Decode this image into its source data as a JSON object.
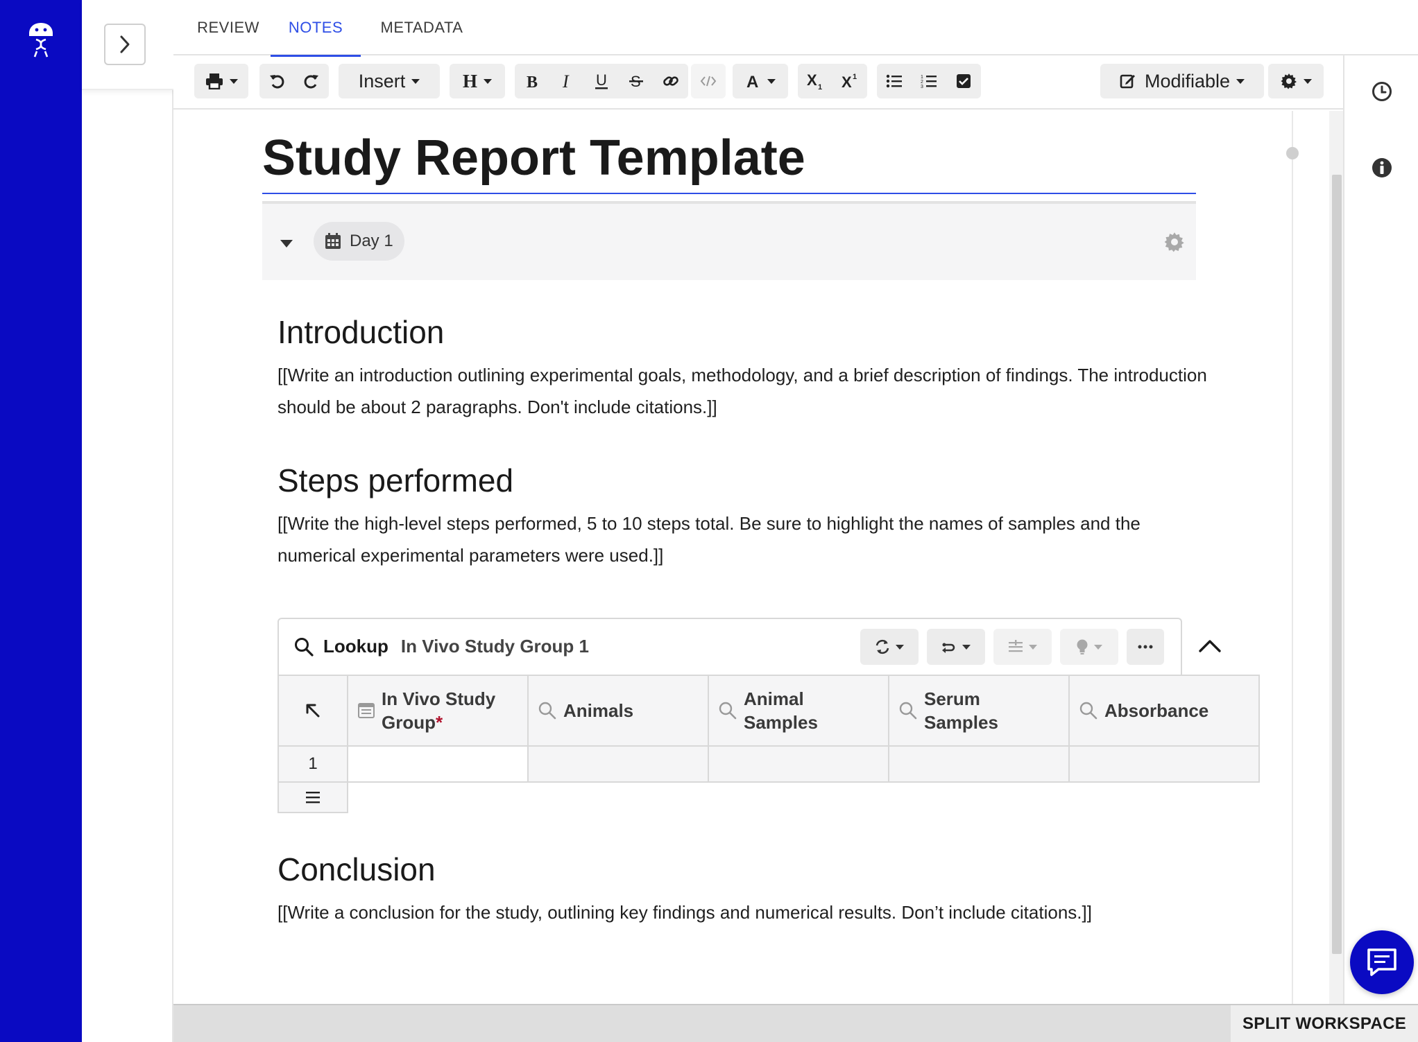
{
  "tabs": [
    {
      "label": "REVIEW",
      "active": false
    },
    {
      "label": "NOTES",
      "active": true
    },
    {
      "label": "METADATA",
      "active": false
    }
  ],
  "toolbar": {
    "insert_label": "Insert",
    "heading_label": "H",
    "mode_label": "Modifiable",
    "icons": [
      "print-icon",
      "undo-icon",
      "redo-icon",
      "bold-icon",
      "italic-icon",
      "underline-icon",
      "strikethrough-icon",
      "link-icon",
      "code-icon",
      "text-color-icon",
      "subscript-icon",
      "superscript-icon",
      "bullet-list-icon",
      "numbered-list-icon",
      "checklist-icon",
      "edit-icon",
      "gear-icon"
    ]
  },
  "document": {
    "title": "Study Report Template",
    "day_label": "Day 1",
    "sections": [
      {
        "heading": "Introduction",
        "body": "[[Write an introduction outlining experimental goals, methodology, and a brief description of findings. The introduction should be about 2 paragraphs. Don't include citations.]]"
      },
      {
        "heading": "Steps performed",
        "body": "[[Write the high-level steps performed, 5 to 10 steps total. Be sure to highlight the names of samples and the numerical experimental parameters were used.]]"
      },
      {
        "heading": "Conclusion",
        "body": "[[Write a conclusion for the study, outlining key findings and numerical results. Don’t include citations.]]"
      }
    ]
  },
  "lookup": {
    "label": "Lookup",
    "entity": "In Vivo Study Group 1",
    "columns": [
      {
        "line1": "In Vivo Study",
        "line2": "Group",
        "required_mark": "*",
        "icon": "table-icon"
      },
      {
        "line1": "Animals",
        "line2": "",
        "required_mark": "",
        "icon": "search-icon"
      },
      {
        "line1": "Animal",
        "line2": "Samples",
        "required_mark": "",
        "icon": "search-icon"
      },
      {
        "line1": "Serum",
        "line2": "Samples",
        "required_mark": "",
        "icon": "search-icon"
      },
      {
        "line1": "Absorbance",
        "line2": "",
        "required_mark": "",
        "icon": "search-icon"
      }
    ],
    "rows": [
      {
        "index": "1"
      }
    ]
  },
  "footer": {
    "split_label": "SPLIT WORKSPACE"
  },
  "colors": {
    "brand": "#0a0ac2",
    "accent": "#2e4ee6",
    "required": "#b0122d"
  }
}
